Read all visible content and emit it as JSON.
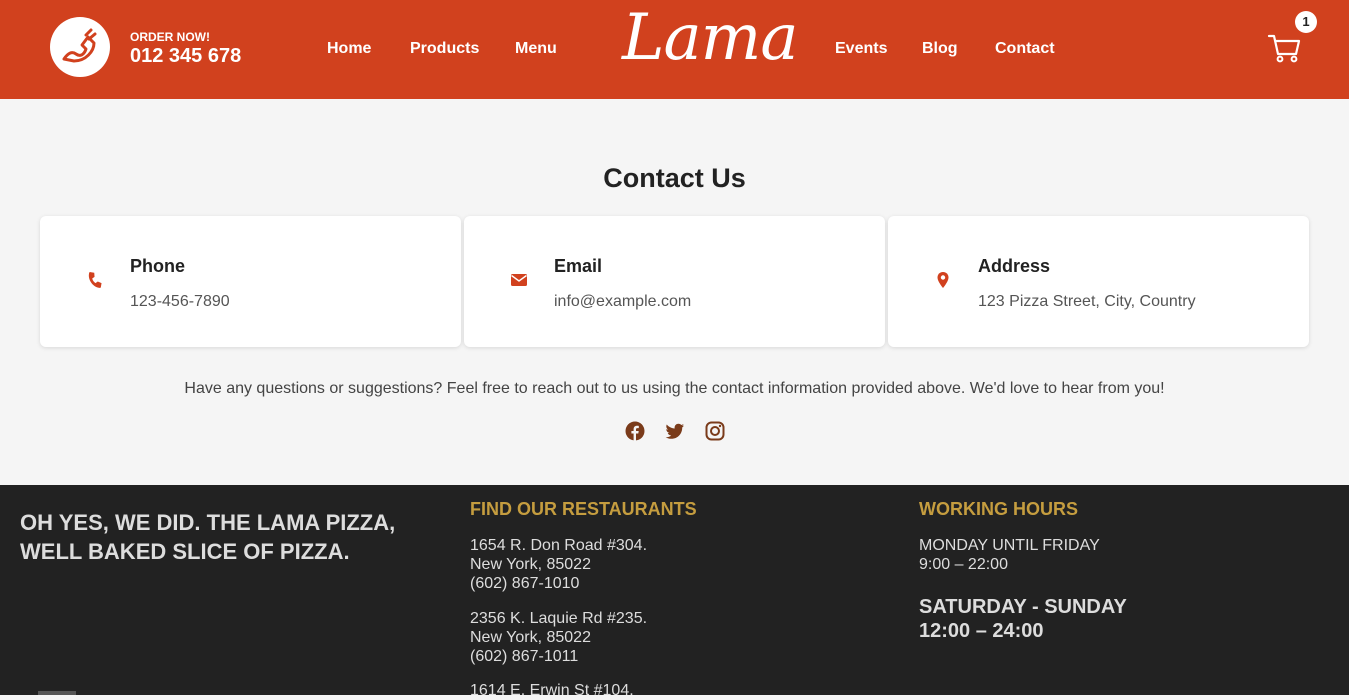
{
  "header": {
    "order_label": "ORDER NOW!",
    "order_number": "012 345 678",
    "logo": "Lama",
    "nav_left": [
      "Home",
      "Products",
      "Menu"
    ],
    "nav_right": [
      "Events",
      "Blog",
      "Contact"
    ],
    "cart_count": "1",
    "background_color": "#d1411e"
  },
  "contact": {
    "title": "Contact Us",
    "cards": [
      {
        "icon": "phone-icon",
        "title": "Phone",
        "value": "123-456-7890"
      },
      {
        "icon": "envelope-icon",
        "title": "Email",
        "value": "info@example.com"
      },
      {
        "icon": "map-marker-icon",
        "title": "Address",
        "value": "123 Pizza Street, City, Country"
      }
    ],
    "blurb": "Have any questions or suggestions? Feel free to reach out to us using the contact information provided above. We'd love to hear from you!",
    "social": [
      "facebook-icon",
      "twitter-icon",
      "instagram-icon"
    ],
    "accent_color": "#d1411e",
    "social_color": "#7a3b1a"
  },
  "footer": {
    "slogan": "OH YES, WE DID. THE LAMA PIZZA, WELL BAKED SLICE OF PIZZA.",
    "restaurants_title": "FIND OUR RESTAURANTS",
    "restaurants": [
      {
        "line1": "1654 R. Don Road #304.",
        "line2": "New York, 85022",
        "line3": "(602) 867-1010"
      },
      {
        "line1": "2356 K. Laquie Rd #235.",
        "line2": "New York, 85022",
        "line3": "(602) 867-1011"
      },
      {
        "line1": "1614 E. Erwin St #104.",
        "line2": "",
        "line3": ""
      }
    ],
    "hours_title": "WORKING HOURS",
    "weekday_label": "MONDAY UNTIL FRIDAY",
    "weekday_hours": "9:00 – 22:00",
    "weekend_label": "SATURDAY - SUNDAY",
    "weekend_hours": "12:00 – 24:00",
    "title_color": "#c59d3f",
    "background_color": "#222222"
  }
}
